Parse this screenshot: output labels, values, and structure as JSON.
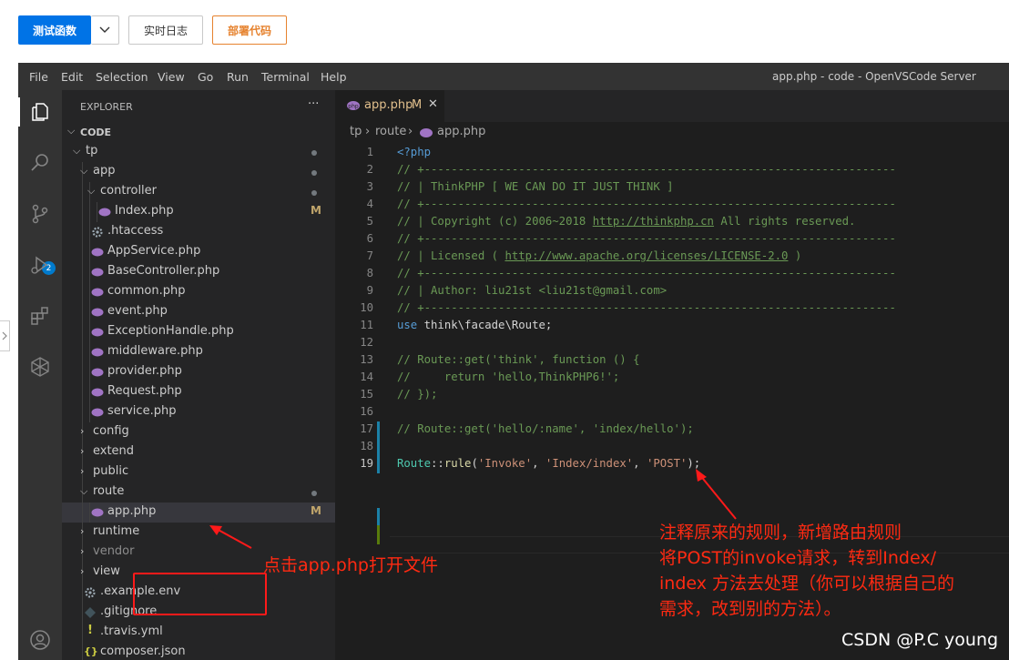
{
  "console": {
    "test_button": "测试函数",
    "dropdown_icon": "chevron-down",
    "log_button": "实时日志",
    "deploy_button": "部署代码"
  },
  "titlebar": {
    "menu": [
      "File",
      "Edit",
      "Selection",
      "View",
      "Go",
      "Run",
      "Terminal",
      "Help"
    ],
    "title": "app.php - code - OpenVSCode Server"
  },
  "activity_badge": "2",
  "explorer": {
    "title": "EXPLORER",
    "more": "···",
    "workspace": "CODE",
    "items": [
      {
        "label": "tp",
        "status": "dot"
      },
      {
        "label": "app",
        "status": "dot"
      },
      {
        "label": "controller",
        "status": "dot"
      },
      {
        "label": "Index.php",
        "status": "M"
      },
      {
        "label": ".htaccess",
        "status": ""
      },
      {
        "label": "AppService.php",
        "status": ""
      },
      {
        "label": "BaseController.php",
        "status": ""
      },
      {
        "label": "common.php",
        "status": ""
      },
      {
        "label": "event.php",
        "status": ""
      },
      {
        "label": "ExceptionHandle.php",
        "status": ""
      },
      {
        "label": "middleware.php",
        "status": ""
      },
      {
        "label": "provider.php",
        "status": ""
      },
      {
        "label": "Request.php",
        "status": ""
      },
      {
        "label": "service.php",
        "status": ""
      },
      {
        "label": "config",
        "status": ""
      },
      {
        "label": "extend",
        "status": ""
      },
      {
        "label": "public",
        "status": ""
      },
      {
        "label": "route",
        "status": "dot"
      },
      {
        "label": "app.php",
        "status": "M"
      },
      {
        "label": "runtime",
        "status": ""
      },
      {
        "label": "vendor",
        "status": ""
      },
      {
        "label": "view",
        "status": ""
      },
      {
        "label": ".example.env",
        "status": ""
      },
      {
        "label": ".gitignore",
        "status": ""
      },
      {
        "label": ".travis.yml",
        "status": ""
      },
      {
        "label": "composer.json",
        "status": ""
      }
    ]
  },
  "editor": {
    "tab_label": "app.php",
    "tab_modified": "M",
    "breadcrumb": [
      "tp",
      "route",
      "app.php"
    ],
    "line_numbers": [
      "1",
      "2",
      "3",
      "4",
      "5",
      "6",
      "7",
      "8",
      "9",
      "10",
      "11",
      "12",
      "13",
      "14",
      "15",
      "16",
      "17",
      "18",
      "19"
    ],
    "code": {
      "l1": "<?php",
      "l2": "// +----------------------------------------------------------------------",
      "l3": "// | ThinkPHP [ WE CAN DO IT JUST THINK ]",
      "l4": "// +----------------------------------------------------------------------",
      "l5a": "// | Copyright (c) 2006~2018 ",
      "l5b": "http://thinkphp.cn",
      "l5c": " All rights reserved.",
      "l6": "// +----------------------------------------------------------------------",
      "l7a": "// | Licensed ( ",
      "l7b": "http://www.apache.org/licenses/LICENSE-2.0",
      "l7c": " )",
      "l8": "// +----------------------------------------------------------------------",
      "l9": "// | Author: liu21st <liu21st@gmail.com>",
      "l10": "// +----------------------------------------------------------------------",
      "l11a": "use",
      "l11b": " think\\facade\\Route;",
      "l13": "// Route::get('think', function () {",
      "l14": "//     return 'hello,ThinkPHP6!';",
      "l15": "// });",
      "l17": "// Route::get('hello/:name', 'index/hello');",
      "l19a": "Route",
      "l19b": "::",
      "l19c": "rule",
      "l19d": "(",
      "l19e": "'Invoke'",
      "l19f": ", ",
      "l19g": "'Index/index'",
      "l19h": ", ",
      "l19i": "'POST'",
      "l19j": ");"
    }
  },
  "annotations": {
    "click_hint": "点击app.php打开文件",
    "note_lines": [
      "注释原来的规则，新增路由规则",
      "将POST的invoke请求，转到Index/",
      "index 方法去处理（你可以根据自己的",
      "需求，改到别的方法）。"
    ]
  },
  "watermark": "CSDN @P.C young",
  "colors": {
    "annotation": "#ff2a12",
    "primary_button": "#0073e6",
    "deploy_border": "#e6822e",
    "modified": "#c0a56b"
  }
}
